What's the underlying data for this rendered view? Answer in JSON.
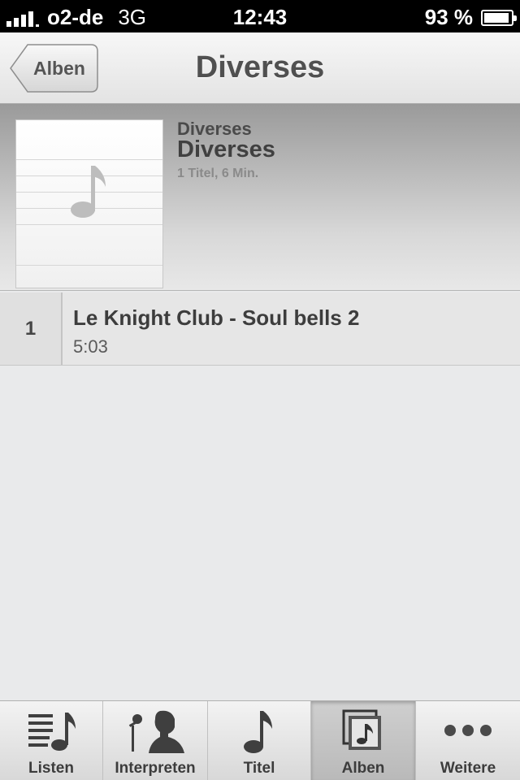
{
  "status_bar": {
    "carrier": "o2-de",
    "network": "3G",
    "time": "12:43",
    "battery": "93 %",
    "battery_level": 0.93
  },
  "nav": {
    "back_label": "Alben",
    "title": "Diverses"
  },
  "album": {
    "artist": "Diverses",
    "title": "Diverses",
    "info": "1 Titel, 6 Min."
  },
  "tracks": [
    {
      "number": "1",
      "title": "Le Knight Club - Soul bells 2",
      "duration": "5:03"
    }
  ],
  "tabs": [
    {
      "label": "Listen",
      "icon": "playlist-icon",
      "active": false
    },
    {
      "label": "Interpreten",
      "icon": "artist-icon",
      "active": false
    },
    {
      "label": "Titel",
      "icon": "music-note-icon",
      "active": false
    },
    {
      "label": "Alben",
      "icon": "album-icon",
      "active": true
    },
    {
      "label": "Weitere",
      "icon": "more-icon",
      "active": false
    }
  ],
  "colors": {
    "status_bar_bg": "#000000",
    "background": "#e9eaeb",
    "text": "#404040"
  }
}
